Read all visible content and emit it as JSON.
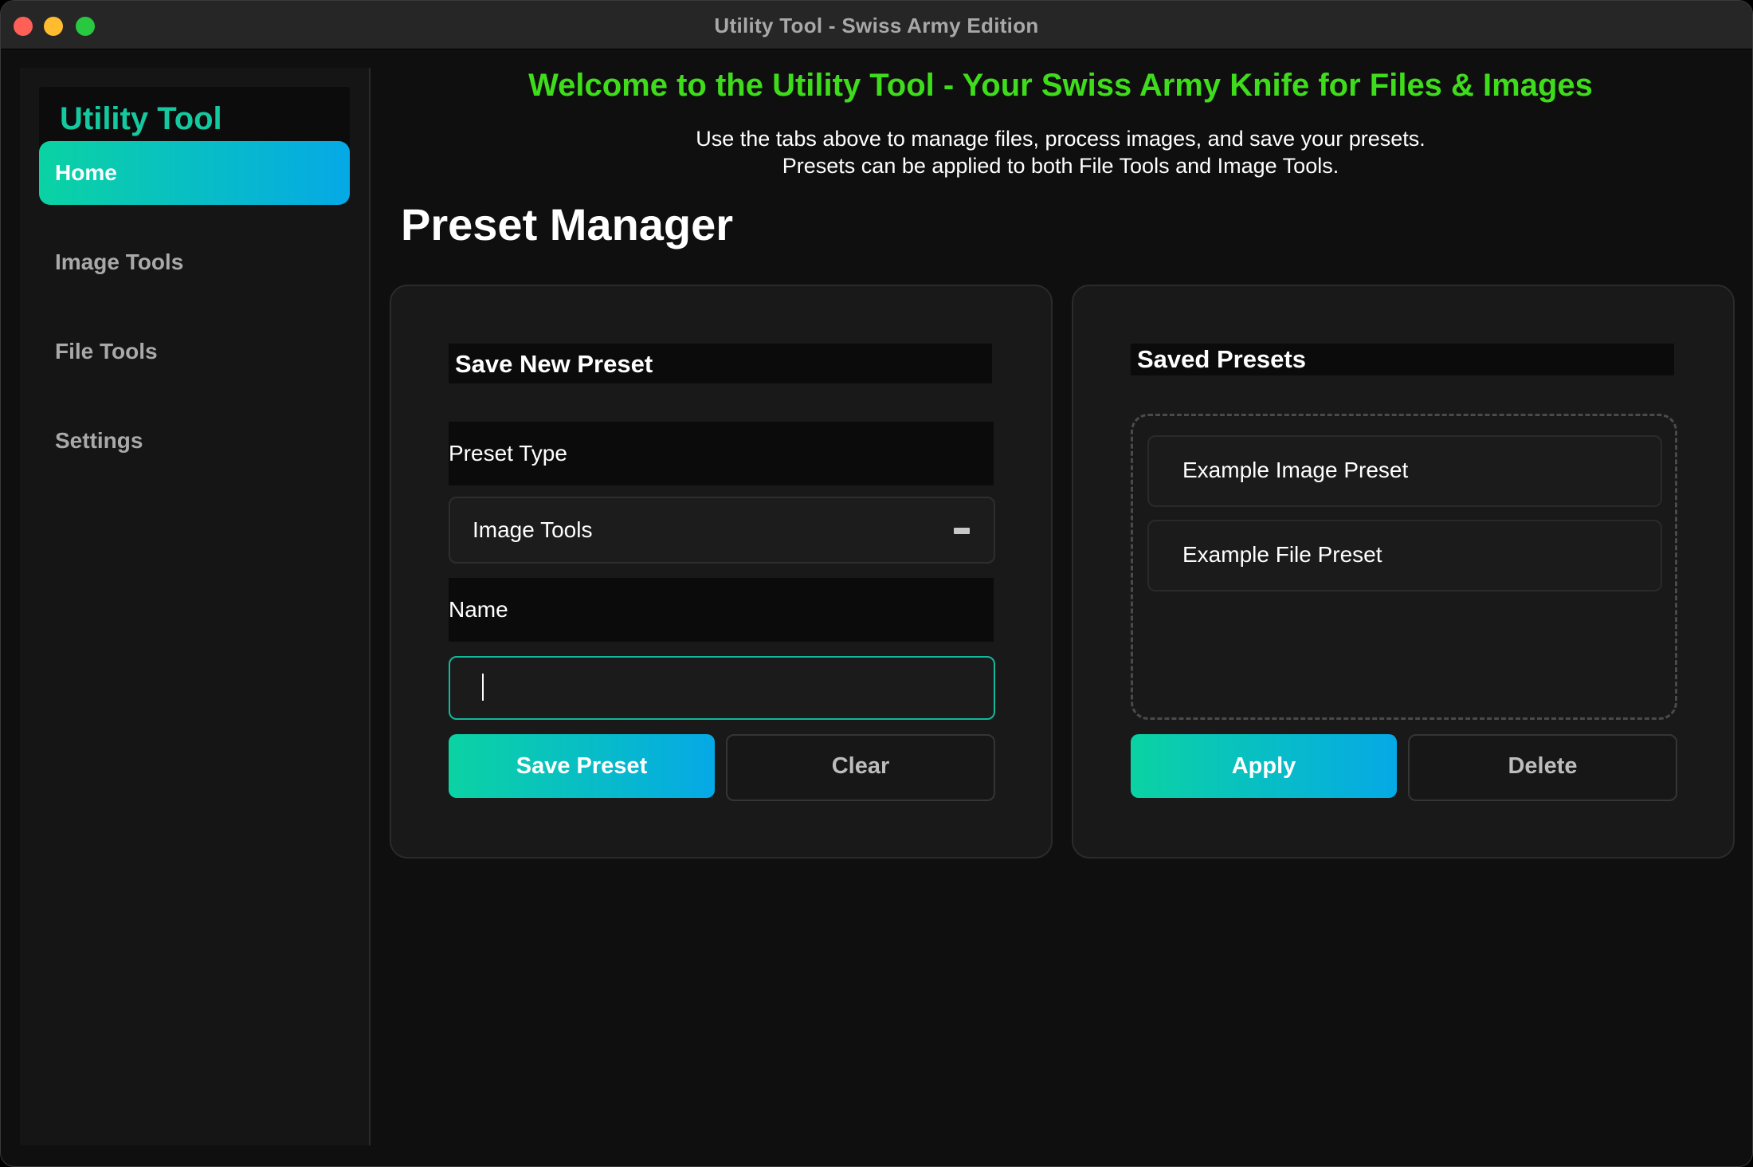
{
  "window": {
    "title": "Utility Tool - Swiss Army Edition"
  },
  "sidebar": {
    "brand": "Utility Tool",
    "items": [
      {
        "label": "Home",
        "active": true
      },
      {
        "label": "Image Tools",
        "active": false
      },
      {
        "label": "File Tools",
        "active": false
      },
      {
        "label": "Settings",
        "active": false
      }
    ]
  },
  "header": {
    "welcome": "Welcome to the Utility Tool - Your Swiss Army Knife for Files & Images",
    "subtitle_line1": "Use the tabs above to manage files, process images, and save your presets.",
    "subtitle_line2": "Presets can be applied to both File Tools and Image Tools."
  },
  "page": {
    "title": "Preset Manager"
  },
  "save_panel": {
    "heading": "Save New Preset",
    "type_label": "Preset Type",
    "type_value": "Image Tools",
    "name_label": "Name",
    "name_value": "",
    "save_button": "Save Preset",
    "clear_button": "Clear"
  },
  "saved_panel": {
    "heading": "Saved Presets",
    "presets": [
      "Example Image Preset",
      "Example File Preset"
    ],
    "apply_button": "Apply",
    "delete_button": "Delete"
  },
  "colors": {
    "accent_start": "#0bd3a3",
    "accent_end": "#05a9e6",
    "welcome_green": "#3fdc1c",
    "brand_teal": "#14c9a0"
  }
}
